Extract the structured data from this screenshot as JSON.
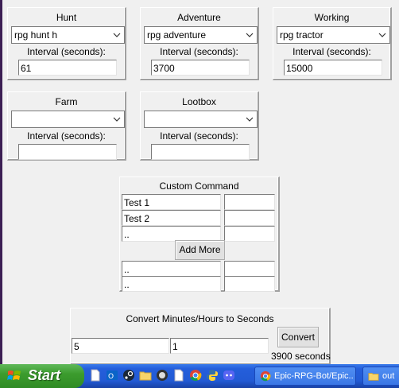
{
  "panels": {
    "hunt": {
      "title": "Hunt",
      "command": "rpg hunt h",
      "interval_label": "Interval (seconds):",
      "interval": "61"
    },
    "adventure": {
      "title": "Adventure",
      "command": "rpg adventure",
      "interval_label": "Interval (seconds):",
      "interval": "3700"
    },
    "working": {
      "title": "Working",
      "command": "rpg tractor",
      "interval_label": "Interval (seconds):",
      "interval": "15000"
    },
    "farm": {
      "title": "Farm",
      "command": "",
      "interval_label": "Interval (seconds):",
      "interval": ""
    },
    "lootbox": {
      "title": "Lootbox",
      "command": "",
      "interval_label": "Interval (seconds):",
      "interval": ""
    }
  },
  "custom": {
    "title": "Custom Command",
    "rows_top": [
      {
        "command": "Test 1",
        "interval": ""
      },
      {
        "command": "Test 2",
        "interval": ""
      },
      {
        "command": "..",
        "interval": ""
      }
    ],
    "add_more_label": "Add More",
    "rows_bottom": [
      {
        "command": "..",
        "interval": ""
      },
      {
        "command": "..",
        "interval": ""
      }
    ]
  },
  "convert": {
    "title": "Convert Minutes/Hours to Seconds",
    "minutes": "5",
    "hours": "1",
    "button_label": "Convert",
    "result": "3900 seconds"
  },
  "taskbar": {
    "start_label": "Start",
    "quick_launch": [
      "file-icon",
      "outlook-icon",
      "steam-icon",
      "folder-icon",
      "obs-icon",
      "file-icon",
      "chrome-icon",
      "python-icon",
      "discord-icon"
    ],
    "tasks": [
      {
        "label": "Epic-RPG-Bot/Epic...",
        "icon": "chrome-icon"
      },
      {
        "label": "out",
        "icon": "folder-icon"
      }
    ]
  }
}
